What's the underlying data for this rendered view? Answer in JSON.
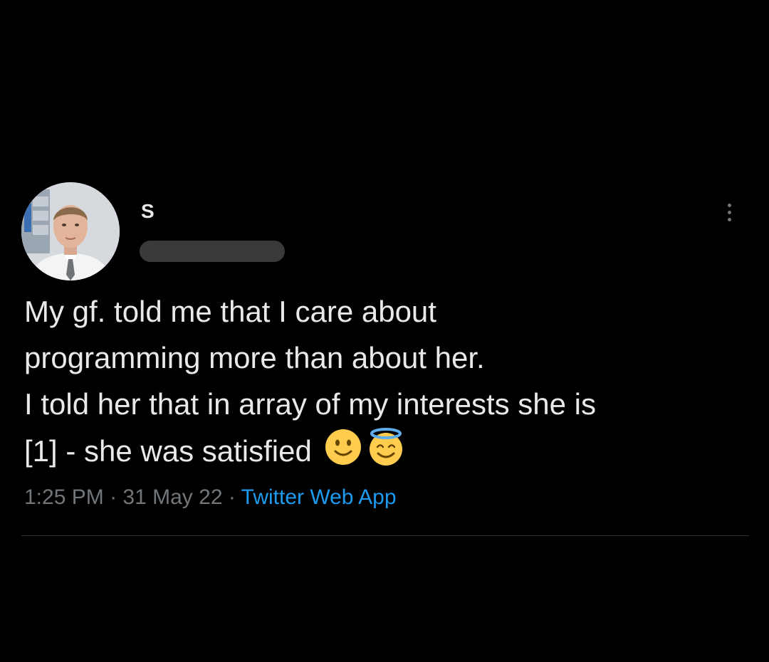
{
  "tweet": {
    "author": {
      "display_name": "S",
      "avatar_icon": "user-photo"
    },
    "text_lines": [
      "My gf. told me that I care about",
      "programming more than about her.",
      "I told her that in array of my interests she is",
      "[1] - she was satisfied"
    ],
    "emojis": [
      "slightly-smiling-face",
      "smiling-face-with-halo"
    ],
    "time": "1:25 PM",
    "separator": "·",
    "date": "31 May 22",
    "source": "Twitter Web App"
  },
  "colors": {
    "background": "#000000",
    "text": "#e7e9ea",
    "muted": "#71767b",
    "link": "#1d9bf0",
    "divider": "#2f3336"
  },
  "icons": {
    "more": "more-horizontal-icon"
  }
}
